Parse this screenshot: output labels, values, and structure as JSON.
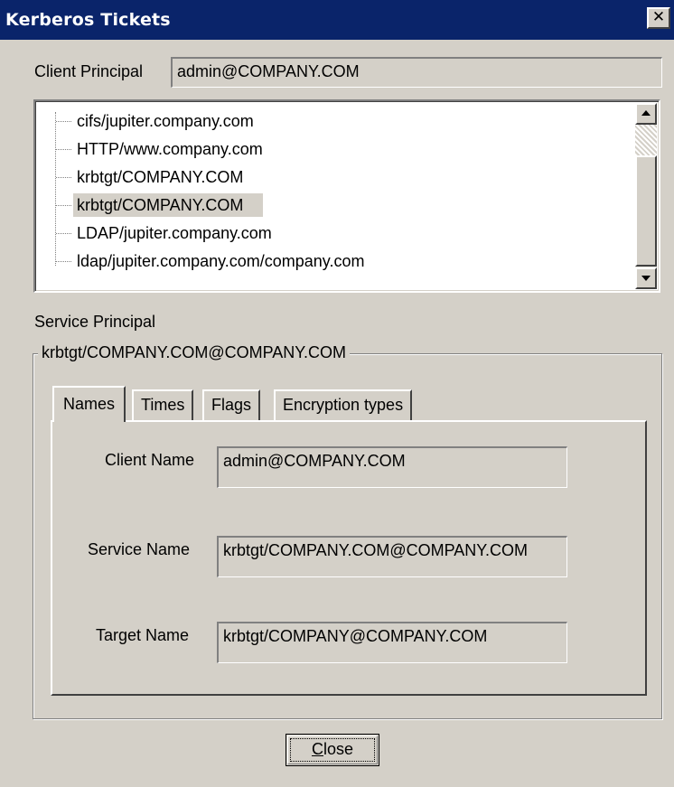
{
  "window": {
    "title": "Kerberos Tickets",
    "close_glyph": "✕",
    "colors": {
      "titlebar": "#0a246a",
      "face": "#d4d0c8"
    }
  },
  "client_principal": {
    "label": "Client Principal",
    "value": "admin@COMPANY.COM"
  },
  "tickets": {
    "items": [
      "cifs/jupiter.company.com",
      "HTTP/www.company.com",
      "krbtgt/COMPANY.COM",
      "krbtgt/COMPANY.COM",
      "LDAP/jupiter.company.com",
      "ldap/jupiter.company.com/company.com"
    ],
    "selected_index": 3
  },
  "service_principal": {
    "label": "Service Principal",
    "group_title": "krbtgt/COMPANY.COM@COMPANY.COM"
  },
  "tabs": [
    {
      "label": "Names",
      "active": true
    },
    {
      "label": "Times",
      "active": false
    },
    {
      "label": "Flags",
      "active": false
    },
    {
      "label": "Encryption types",
      "active": false
    }
  ],
  "names_tab": {
    "client_name_label": "Client Name",
    "client_name_value": "admin@COMPANY.COM",
    "service_name_label": "Service Name",
    "service_name_value": "krbtgt/COMPANY.COM@COMPANY.COM",
    "target_name_label": "Target Name",
    "target_name_value": "krbtgt/COMPANY@COMPANY.COM"
  },
  "buttons": {
    "close_mnemonic": "C",
    "close_rest": "lose"
  }
}
